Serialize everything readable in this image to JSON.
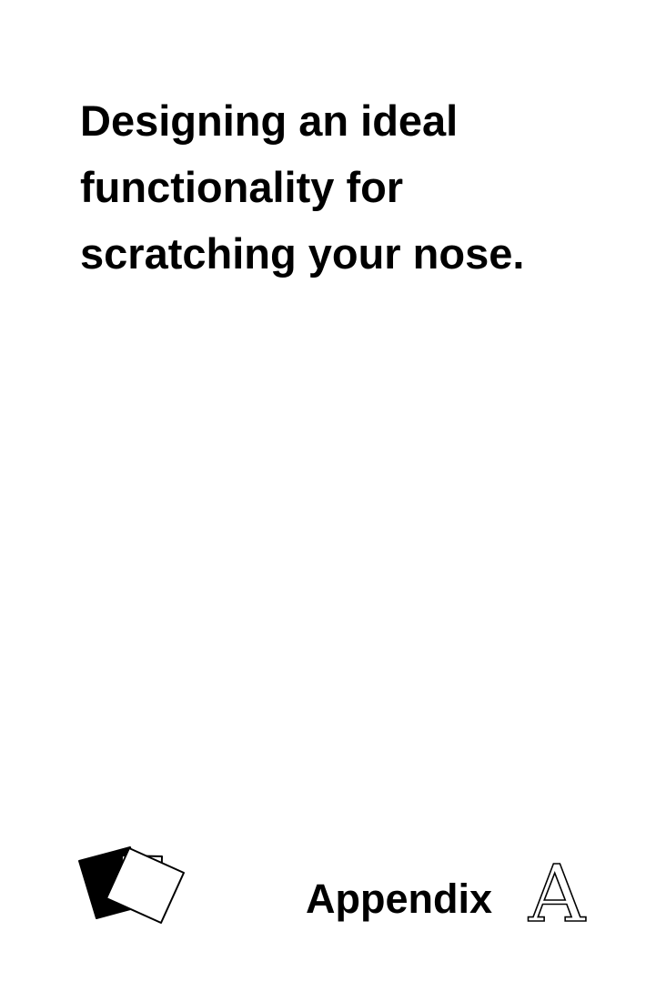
{
  "title_lines": [
    "Designing an ideal",
    "functionality for",
    "scratching your nose."
  ],
  "footer": {
    "label": "Appendix",
    "letter": "A"
  },
  "icons": {
    "logo": "stacked-cards-icon"
  },
  "colors": {
    "text": "#000000",
    "background": "#ffffff"
  }
}
